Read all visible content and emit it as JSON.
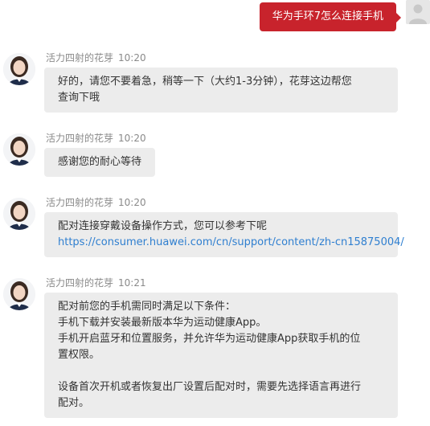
{
  "user_message": {
    "text": "华为手环7怎么连接手机"
  },
  "messages": [
    {
      "sender": "活力四射的花芽",
      "time": "10:20",
      "lines": [
        "好的，请您不要着急，稍等一下（大约1-3分钟），花芽这边帮您",
        "查询下哦"
      ]
    },
    {
      "sender": "活力四射的花芽",
      "time": "10:20",
      "lines": [
        "感谢您的耐心等待"
      ]
    },
    {
      "sender": "活力四射的花芽",
      "time": "10:20",
      "lines": [
        "配对连接穿戴设备操作方式，您可以参考下呢"
      ],
      "link": "https://consumer.huawei.com/cn/support/content/zh-cn15875004/"
    },
    {
      "sender": "活力四射的花芽",
      "time": "10:21",
      "lines": [
        "配对前您的手机需同时满足以下条件：",
        "手机下载并安装最新版本华为运动健康App。",
        "手机开启蓝牙和位置服务，并允许华为运动健康App获取手机的位",
        "置权限。",
        "",
        "设备首次开机或者恢复出厂设置后配对时，需要先选择语言再进行",
        "配对。"
      ]
    }
  ],
  "colors": {
    "user_bubble": "#c8232c",
    "agent_bubble": "#ececec",
    "link": "#2f7fd0",
    "meta": "#8a8a8a"
  }
}
